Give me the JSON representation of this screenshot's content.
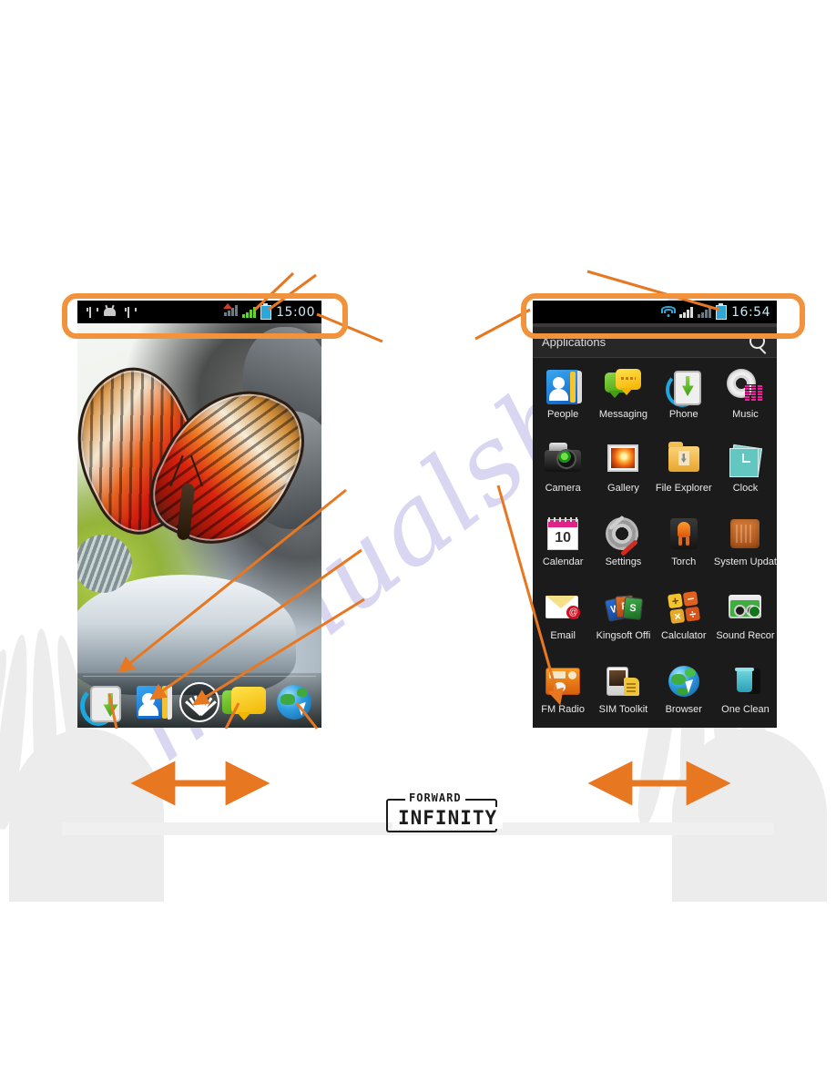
{
  "document": {
    "brand_logo_top": "FORWARD",
    "brand_logo_bottom": "INFINITY",
    "watermark_text": "manualshive",
    "accent_color": "#e87722",
    "callout_color": "#f0933c"
  },
  "left_phone": {
    "name": "home-screen",
    "statusbar": {
      "time": "15:00",
      "left_icons": [
        "usb-icon",
        "android-debug-icon",
        "usb-icon"
      ],
      "right_icons": [
        "signal-bars-icon",
        "signal-bars-icon",
        "battery-icon"
      ]
    },
    "wallpaper_name": "butterfly-wallpaper",
    "dock": [
      {
        "label": "Phone",
        "icon": "phone-icon"
      },
      {
        "label": "People",
        "icon": "people-icon"
      },
      {
        "label": "Applications",
        "icon": "app-drawer-icon"
      },
      {
        "label": "Messaging",
        "icon": "messaging-icon"
      },
      {
        "label": "Browser",
        "icon": "browser-icon"
      }
    ]
  },
  "right_phone": {
    "name": "applications-screen",
    "statusbar": {
      "time": "16:54",
      "right_icons": [
        "wifi-icon",
        "signal-bars-icon",
        "signal-bars-icon",
        "battery-icon"
      ]
    },
    "header": {
      "title": "Applications",
      "search_icon": "search-icon"
    },
    "apps": [
      {
        "label": "People",
        "icon": "people-icon"
      },
      {
        "label": "Messaging",
        "icon": "messaging-icon"
      },
      {
        "label": "Phone",
        "icon": "phone-icon"
      },
      {
        "label": "Music",
        "icon": "music-icon"
      },
      {
        "label": "Camera",
        "icon": "camera-icon"
      },
      {
        "label": "Gallery",
        "icon": "gallery-icon"
      },
      {
        "label": "File Explorer",
        "icon": "file-explorer-icon"
      },
      {
        "label": "Clock",
        "icon": "clock-icon"
      },
      {
        "label": "Calendar",
        "icon": "calendar-icon"
      },
      {
        "label": "Settings",
        "icon": "settings-icon"
      },
      {
        "label": "Torch",
        "icon": "torch-icon"
      },
      {
        "label": "System Updat",
        "icon": "system-update-icon"
      },
      {
        "label": "Email",
        "icon": "email-icon"
      },
      {
        "label": "Kingsoft Offi",
        "icon": "kingsoft-office-icon"
      },
      {
        "label": "Calculator",
        "icon": "calculator-icon"
      },
      {
        "label": "Sound Recor",
        "icon": "sound-recorder-icon"
      },
      {
        "label": "FM Radio",
        "icon": "fm-radio-icon"
      },
      {
        "label": "SIM Toolkit",
        "icon": "sim-toolkit-icon"
      },
      {
        "label": "Browser",
        "icon": "browser-icon"
      },
      {
        "label": "One Clean",
        "icon": "one-clean-icon"
      }
    ],
    "calendar_day": "10",
    "calculator_keys": [
      "+",
      "−",
      "×",
      "÷"
    ],
    "email_badge": "@"
  }
}
